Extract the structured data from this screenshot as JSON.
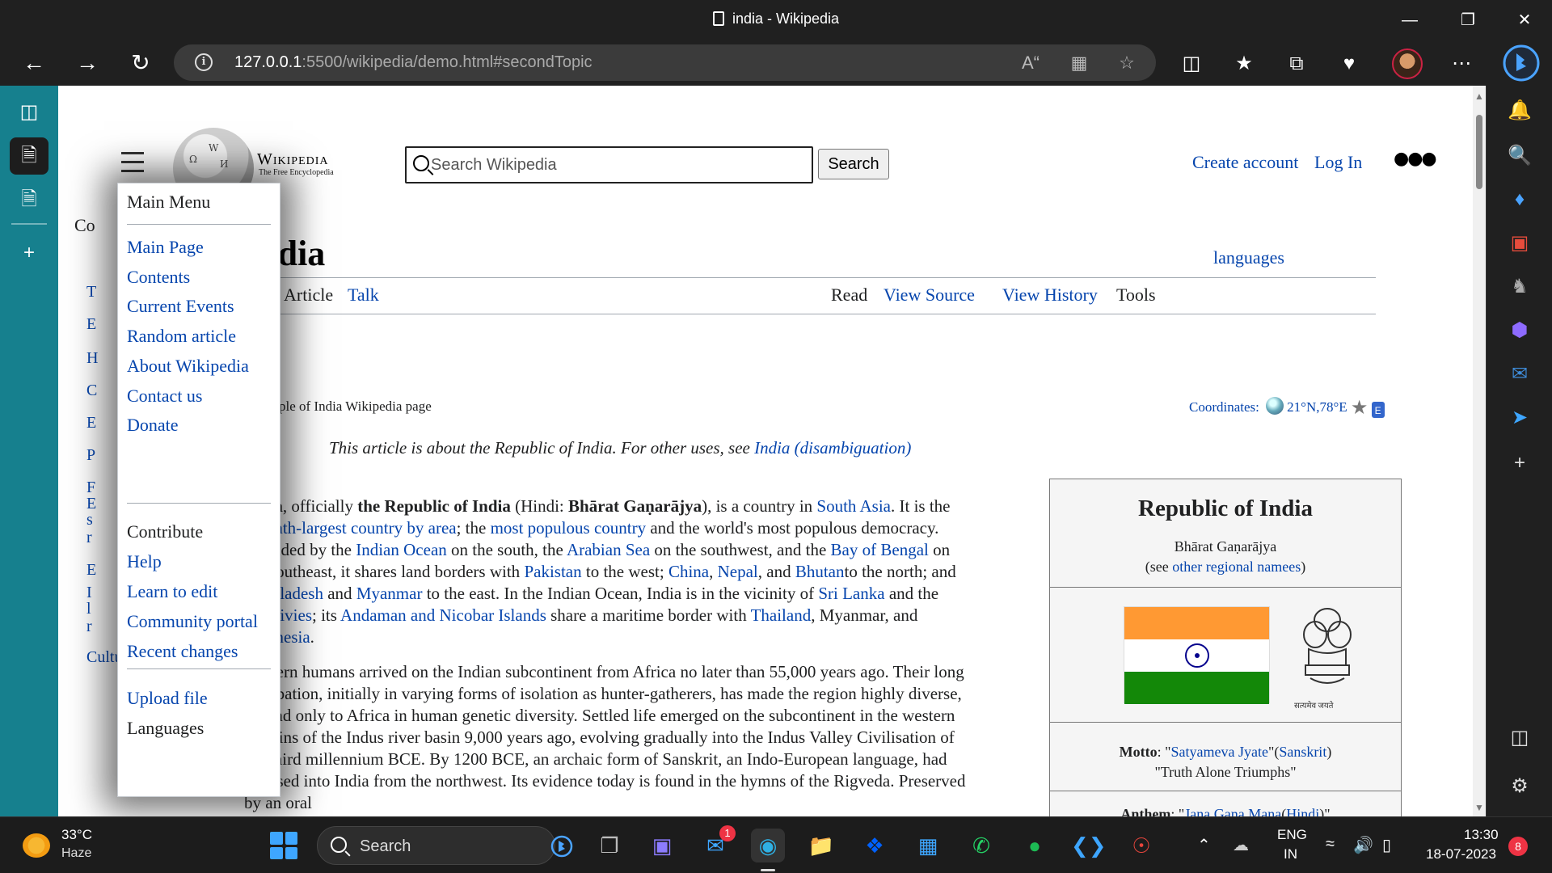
{
  "browser": {
    "tab_title": "india - Wikipedia",
    "url_host": "127.0.0.1",
    "url_rest": ":5500/wikipedia/demo.html#secondTopic",
    "read_aloud_label": "A̅"
  },
  "wiki": {
    "wordmark": "Wikipedia",
    "tagline": "The Free Encyclopedia",
    "search_placeholder": "Search Wikipedia",
    "search_button": "Search",
    "create_account": "Create account",
    "log_in": "Log In",
    "more": "●●●",
    "toc_peek": "Co",
    "left_letters": [
      "T",
      "E",
      "H",
      "C",
      "E",
      "P",
      "F",
      "E",
      "s",
      "r",
      "E",
      "I",
      "l",
      "r"
    ],
    "left_bottom_link": "Culture",
    "title": "India",
    "languages": "languages",
    "tabs": {
      "article": "Article",
      "talk": "Talk",
      "read": "Read",
      "view_source": "View Source",
      "view_history": "View History",
      "tools": "Tools"
    },
    "subtitle": "A sample of India Wikipedia page",
    "coordinates_label": "Coordinates:",
    "coordinates_value": "21°N,78°E",
    "hatnote_text": "This article is about the Republic of India. For other uses, see ",
    "hatnote_link": "India (disambiguation)"
  },
  "menu": {
    "header": "Main Menu",
    "items": [
      "Main Page",
      "Contents",
      "Current Events",
      "Random article",
      "About Wikipedia",
      "Contact us",
      "Donate"
    ],
    "contribute_label": "Contribute",
    "contribute_items": [
      "Help",
      "Learn to edit",
      "Community portal",
      "Recent changes"
    ],
    "upload": "Upload file",
    "languages_label": "Languages"
  },
  "infobox": {
    "title": "Republic of India",
    "native": "Bhārat Gaṇarājya",
    "see_pre": "(see ",
    "see_link": "other regional namees",
    "see_post": ")",
    "emblem_caption": "सत्यमेव जयते",
    "motto_label": "Motto",
    "motto_link": "Satyameva Jyate",
    "motto_lang": "Sanskrit",
    "motto_translation": "\"Truth Alone Triumphs\"",
    "anthem_label": "Anthem",
    "anthem_link": "Jana Gana Mana",
    "anthem_lang": "Hindi"
  },
  "taskbar": {
    "temperature": "33°C",
    "weather": "Haze",
    "search_label": "Search",
    "mail_badge": "1",
    "lang_top": "ENG",
    "lang_bottom": "IN",
    "time": "13:30",
    "date": "18-07-2023",
    "notifications": "8"
  },
  "colors": {
    "link": "#0645ad",
    "sidebar_teal": "#16808e",
    "flag_saffron": "#ff9933",
    "flag_green": "#138808"
  }
}
